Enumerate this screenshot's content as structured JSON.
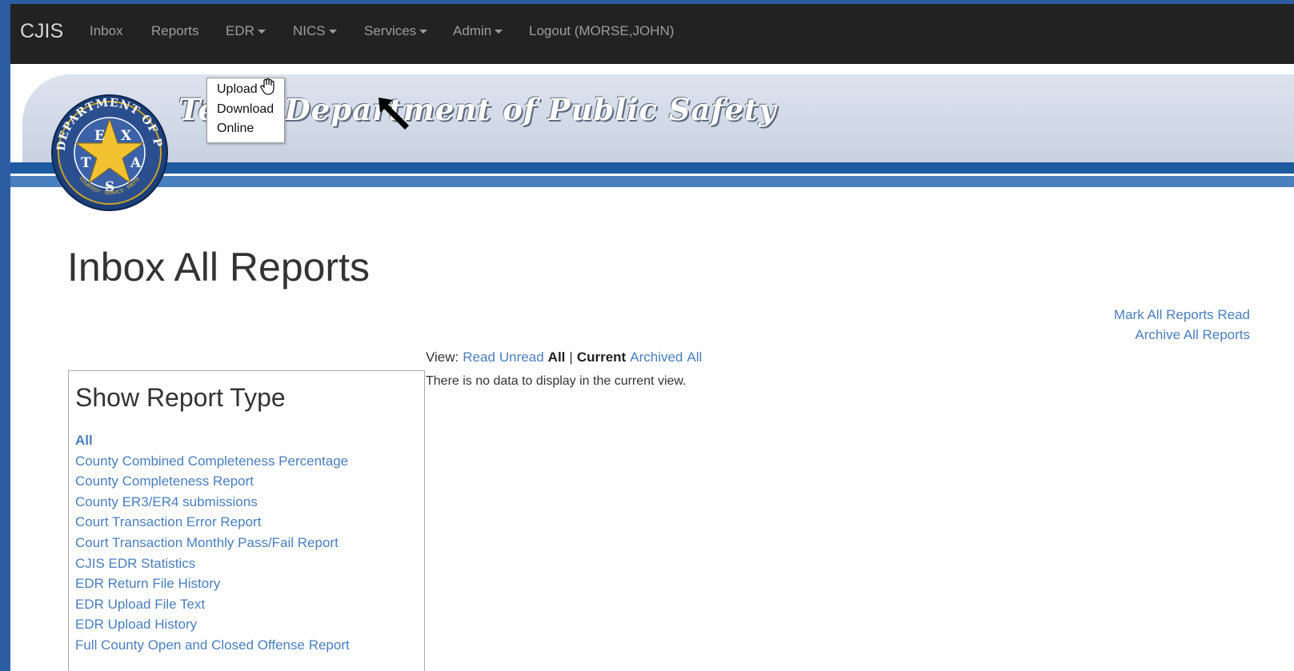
{
  "navbar": {
    "brand": "CJIS",
    "items": [
      {
        "label": "Inbox",
        "caret": false
      },
      {
        "label": "Reports",
        "caret": false
      },
      {
        "label": "EDR",
        "caret": true
      },
      {
        "label": "NICS",
        "caret": true
      },
      {
        "label": "Services",
        "caret": true
      },
      {
        "label": "Admin",
        "caret": true
      },
      {
        "label": "Logout (MORSE,JOHN)",
        "caret": false
      }
    ]
  },
  "banner": {
    "title": "Texas Department of Public Safety",
    "seal_text": "DEPARTMENT OF PUBLIC SAFETY",
    "seal_letters": [
      "T",
      "E",
      "X",
      "A",
      "S"
    ],
    "seal_motto": "COURTESY · SERVICE · PROTECTION"
  },
  "edr_dropdown": {
    "items": [
      "Upload",
      "Download",
      "Online"
    ]
  },
  "page": {
    "title": "Inbox All Reports"
  },
  "actions": {
    "mark_read": "Mark All Reports Read",
    "archive_all": "Archive All Reports"
  },
  "view_bar": {
    "prefix": "View:",
    "read": "Read",
    "unread": "Unread",
    "all_status": "All",
    "separator": "|",
    "current": "Current",
    "archived": "Archived",
    "all_archive": "All"
  },
  "message": {
    "no_data": "There is no data to display in the current view."
  },
  "report_types": {
    "heading": "Show Report Type",
    "items": [
      "All",
      "County Combined Completeness Percentage",
      "County Completeness Report",
      "County ER3/ER4 submissions",
      "Court Transaction Error Report",
      "Court Transaction Monthly Pass/Fail Report",
      "CJIS EDR Statistics",
      "EDR Return File History",
      "EDR Upload File Text",
      "EDR Upload History",
      "Full County Open and Closed Offense Report"
    ]
  },
  "colors": {
    "outer_border": "#2c5da3",
    "navbar_bg": "#222222",
    "link": "#4a7ebc",
    "text": "#333333"
  }
}
